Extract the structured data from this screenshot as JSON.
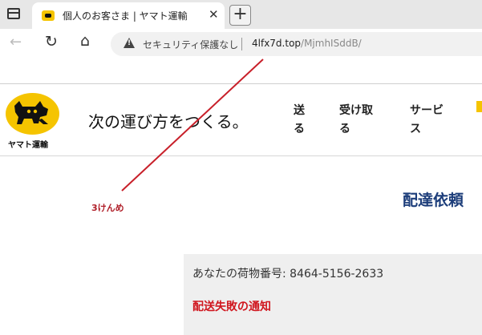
{
  "browser": {
    "tab_title": "個人のお客さま | ヤマト運輸",
    "tab_close": "✕",
    "new_tab": "+",
    "nav_back": "←",
    "nav_reload": "↻",
    "nav_home": "⌂",
    "security_text": "セキュリティ保護なし",
    "url_host": "4lfx7d.top",
    "url_path": "/MjmhISddB/"
  },
  "site": {
    "logo_text": "ヤマト運輸",
    "slogan": "次の運び方をつくる。",
    "nav": {
      "send": "送る",
      "receive": "受け取る",
      "services": "サービス"
    },
    "brand_color": "#f5c400"
  },
  "content": {
    "heading": "配達依頼",
    "annotation": "3けんめ",
    "annotation_color": "#b0202a",
    "tracking_line": "あなたの荷物番号: 8464-5156-2633",
    "notice_title": "配送失敗の通知",
    "notice_color": "#d0161e"
  }
}
